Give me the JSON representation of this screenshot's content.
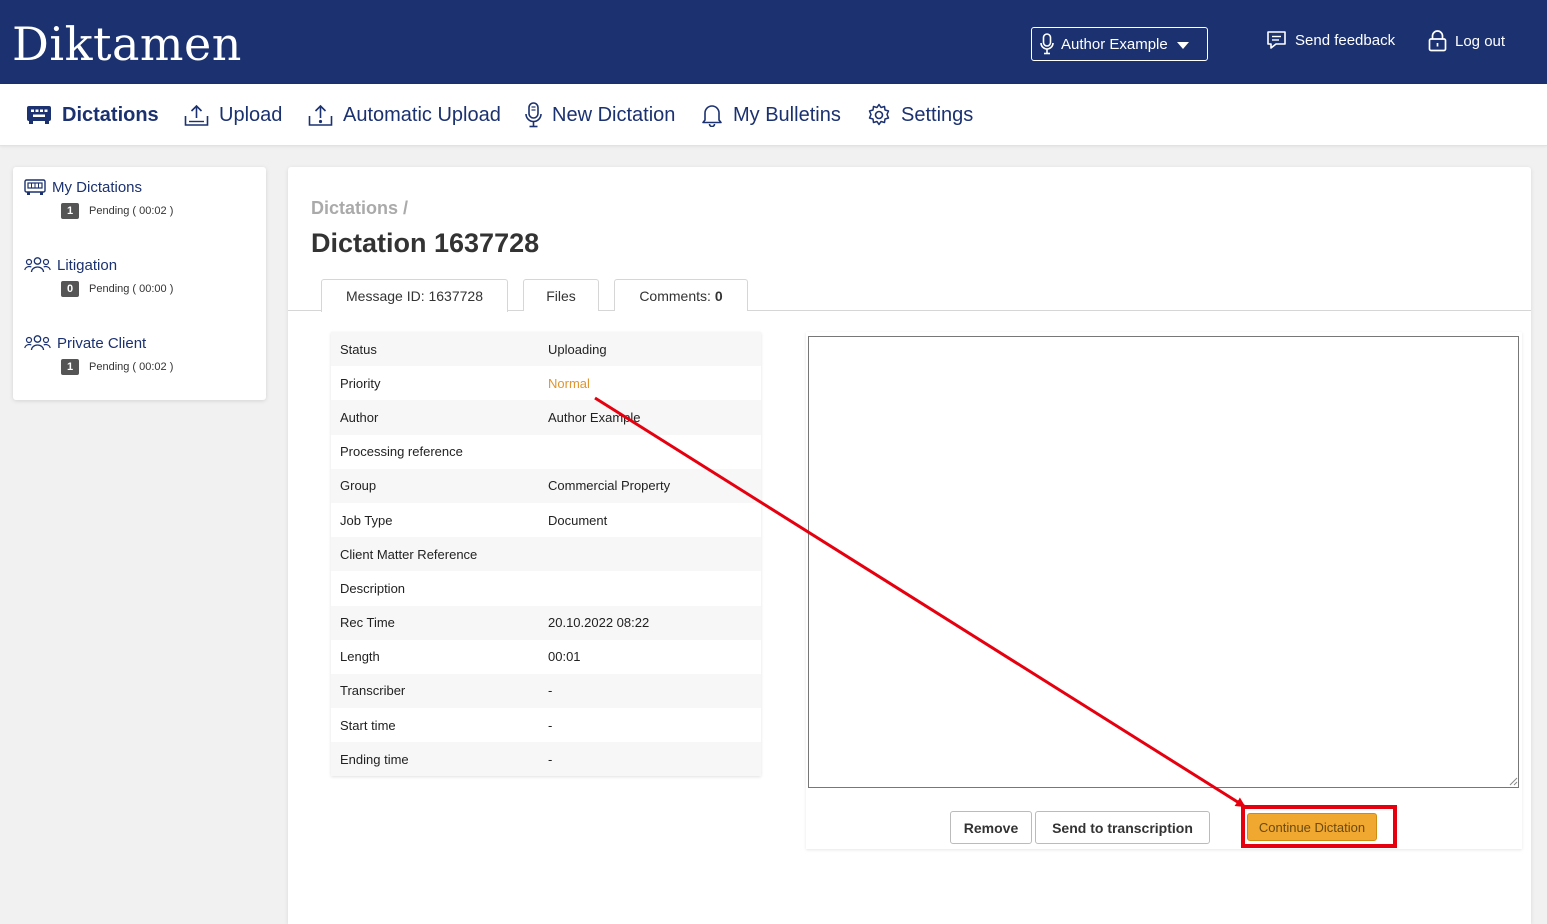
{
  "header": {
    "logo": "Diktamen",
    "author_label": "Author Example",
    "feedback_label": "Send feedback",
    "logout_label": "Log out",
    "bg_color": "#1b3170"
  },
  "nav": {
    "items": [
      {
        "label": "Dictations",
        "icon": "dictation-icon",
        "active": true
      },
      {
        "label": "Upload",
        "icon": "upload-icon"
      },
      {
        "label": "Automatic Upload",
        "icon": "automatic-upload-icon"
      },
      {
        "label": "New Dictation",
        "icon": "microphone-icon"
      },
      {
        "label": "My Bulletins",
        "icon": "bell-icon"
      },
      {
        "label": "Settings",
        "icon": "gear-icon"
      }
    ]
  },
  "sidebar": {
    "groups": [
      {
        "title": "My Dictations",
        "icon": "dictation-icon",
        "count": "1",
        "status": "Pending ( 00:02 )"
      },
      {
        "title": "Litigation",
        "icon": "group-icon",
        "count": "0",
        "status": "Pending ( 00:00 )"
      },
      {
        "title": "Private Client",
        "icon": "group-icon",
        "count": "1",
        "status": "Pending ( 00:02 )"
      }
    ]
  },
  "main": {
    "breadcrumb": "Dictations /",
    "title": "Dictation 1637728",
    "tabs": [
      {
        "label": "Message ID: 1637728"
      },
      {
        "label": "Files"
      },
      {
        "label": "Comments:",
        "count": "0"
      }
    ],
    "details": [
      {
        "key": "Status",
        "value": "Uploading"
      },
      {
        "key": "Priority",
        "value": "Normal",
        "color": "#e0962e"
      },
      {
        "key": "Author",
        "value": "Author Example"
      },
      {
        "key": "Processing reference",
        "value": ""
      },
      {
        "key": "Group",
        "value": "Commercial Property"
      },
      {
        "key": "Job Type",
        "value": "Document"
      },
      {
        "key": "Client Matter Reference",
        "value": ""
      },
      {
        "key": "Description",
        "value": ""
      },
      {
        "key": "Rec Time",
        "value": "20.10.2022 08:22"
      },
      {
        "key": "Length",
        "value": "00:01"
      },
      {
        "key": "Transcriber",
        "value": "-"
      },
      {
        "key": "Start time",
        "value": "-"
      },
      {
        "key": "Ending time",
        "value": "-"
      }
    ],
    "buttons": {
      "remove": "Remove",
      "send": "Send to transcription",
      "continue": "Continue Dictation"
    },
    "accent_color": "#f0a830"
  },
  "annotation": {
    "arrow_color": "#e6000f",
    "highlight_target": "continue-dictation-button"
  }
}
